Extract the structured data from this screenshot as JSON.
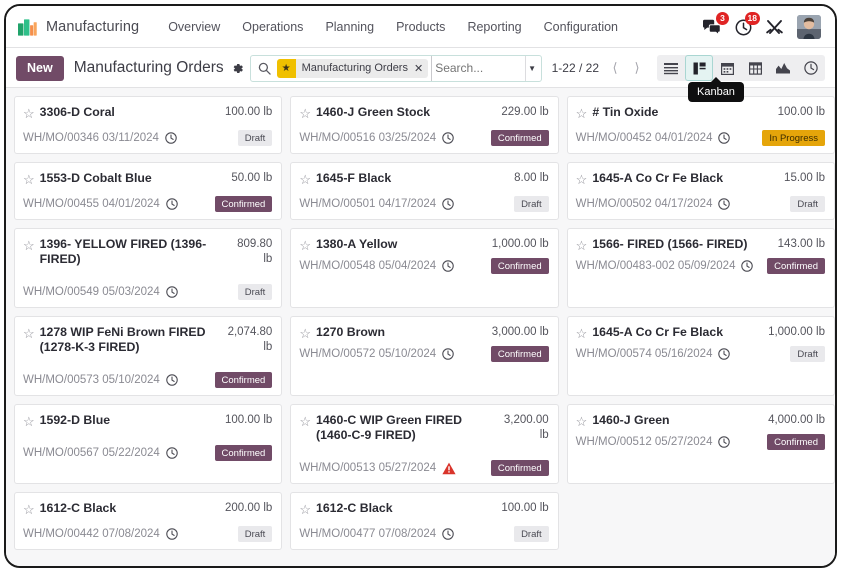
{
  "app": {
    "brand": "Manufacturing",
    "logo_icon": "manufacturing-logo-icon"
  },
  "navmenu": [
    {
      "label": "Overview"
    },
    {
      "label": "Operations"
    },
    {
      "label": "Planning"
    },
    {
      "label": "Products"
    },
    {
      "label": "Reporting"
    },
    {
      "label": "Configuration"
    }
  ],
  "nav_right": {
    "messages_icon": "chat-bubbles-icon",
    "messages_count": "3",
    "activities_icon": "clock-activity-icon",
    "activities_count": "18",
    "debug_icon": "wrench-tools-icon",
    "avatar_icon": "user-avatar"
  },
  "controlpanel": {
    "new_label": "New",
    "title": "Manufacturing Orders",
    "gear_icon": "gear-icon",
    "search": {
      "icon": "search-icon",
      "facet_star_icon": "star-filled-icon",
      "facet_label": "Manufacturing Orders",
      "facet_remove_icon": "close-x-icon",
      "placeholder": "Search...",
      "value": "",
      "dropdown_icon": "caret-down-icon"
    },
    "pager": {
      "count": "1-22 / 22",
      "prev_icon": "chevron-left-icon",
      "next_icon": "chevron-right-icon"
    },
    "views": [
      {
        "name": "list",
        "icon": "list-view-icon",
        "active": false
      },
      {
        "name": "kanban",
        "icon": "kanban-view-icon",
        "active": true
      },
      {
        "name": "calendar",
        "icon": "calendar-view-icon",
        "active": false
      },
      {
        "name": "pivot",
        "icon": "pivot-view-icon",
        "active": false
      },
      {
        "name": "graph",
        "icon": "graph-view-icon",
        "active": false
      },
      {
        "name": "activity",
        "icon": "activity-view-icon",
        "active": false
      }
    ],
    "tooltip": "Kanban"
  },
  "kanban": {
    "columns": [
      {
        "cards": [
          {
            "title": "3306-D Coral",
            "qty": "100.00 lb",
            "ref": "WH/MO/00346 03/11/2024",
            "icon": "clock-icon",
            "state": "Draft",
            "state_class": "draft",
            "tall": false
          },
          {
            "title": "1553-D Cobalt Blue",
            "qty": "50.00 lb",
            "ref": "WH/MO/00455 04/01/2024",
            "icon": "clock-icon",
            "state": "Confirmed",
            "state_class": "confirmed",
            "tall": false
          },
          {
            "title": "1396- YELLOW FIRED (1396- FIRED)",
            "qty": "809.80\nlb",
            "ref": "WH/MO/00549 05/03/2024",
            "icon": "clock-icon",
            "state": "Draft",
            "state_class": "draft",
            "tall": true
          },
          {
            "title": "1278 WIP FeNi Brown FIRED (1278-K-3 FIRED)",
            "qty": "2,074.80\nlb",
            "ref": "WH/MO/00573 05/10/2024",
            "icon": "clock-icon",
            "state": "Confirmed",
            "state_class": "confirmed",
            "tall": true
          },
          {
            "title": "1592-D Blue",
            "qty": "100.00 lb",
            "ref": "WH/MO/00567 05/22/2024",
            "icon": "clock-icon",
            "state": "Confirmed",
            "state_class": "confirmed",
            "tall": true
          },
          {
            "title": "1612-C Black",
            "qty": "200.00 lb",
            "ref": "WH/MO/00442 07/08/2024",
            "icon": "clock-icon",
            "state": "Draft",
            "state_class": "draft",
            "tall": false
          }
        ]
      },
      {
        "cards": [
          {
            "title": "1460-J Green Stock",
            "qty": "229.00 lb",
            "ref": "WH/MO/00516 03/25/2024",
            "icon": "clock-icon",
            "state": "Confirmed",
            "state_class": "confirmed",
            "tall": false
          },
          {
            "title": "1645-F Black",
            "qty": "8.00 lb",
            "ref": "WH/MO/00501 04/17/2024",
            "icon": "clock-icon",
            "state": "Draft",
            "state_class": "draft",
            "tall": false
          },
          {
            "title": "1380-A Yellow",
            "qty": "1,000.00 lb",
            "ref": "WH/MO/00548 05/04/2024",
            "icon": "clock-icon",
            "state": "Confirmed",
            "state_class": "confirmed",
            "tall": true
          },
          {
            "title": "1270 Brown",
            "qty": "3,000.00 lb",
            "ref": "WH/MO/00572 05/10/2024",
            "icon": "clock-icon",
            "state": "Confirmed",
            "state_class": "confirmed",
            "tall": true
          },
          {
            "title": "1460-C WIP Green FIRED (1460-C-9 FIRED)",
            "qty": "3,200.00\nlb",
            "ref": "WH/MO/00513 05/27/2024",
            "icon": "alert-icon",
            "state": "Confirmed",
            "state_class": "confirmed",
            "tall": true
          },
          {
            "title": "1612-C Black",
            "qty": "100.00 lb",
            "ref": "WH/MO/00477 07/08/2024",
            "icon": "clock-icon",
            "state": "Draft",
            "state_class": "draft",
            "tall": false
          }
        ]
      },
      {
        "cards": [
          {
            "title": "# Tin Oxide",
            "qty": "100.00 lb",
            "ref": "WH/MO/00452 04/01/2024",
            "icon": "clock-icon",
            "state": "In Progress",
            "state_class": "progress",
            "tall": false
          },
          {
            "title": "1645-A Co Cr Fe Black",
            "qty": "15.00 lb",
            "ref": "WH/MO/00502 04/17/2024",
            "icon": "clock-icon",
            "state": "Draft",
            "state_class": "draft",
            "tall": false
          },
          {
            "title": "1566- FIRED (1566- FIRED)",
            "qty": "143.00 lb",
            "ref": "WH/MO/00483-002 05/09/2024",
            "icon": "clock-icon",
            "state": "Confirmed",
            "state_class": "confirmed",
            "tall": true
          },
          {
            "title": "1645-A Co Cr Fe Black",
            "qty": "1,000.00 lb",
            "ref": "WH/MO/00574 05/16/2024",
            "icon": "clock-icon",
            "state": "Draft",
            "state_class": "draft",
            "tall": true
          },
          {
            "title": "1460-J Green",
            "qty": "4,000.00 lb",
            "ref": "WH/MO/00512 05/27/2024",
            "icon": "clock-icon",
            "state": "Confirmed",
            "state_class": "confirmed",
            "tall": true
          }
        ]
      }
    ]
  },
  "colors": {
    "primary": "#714b67",
    "in_progress": "#e5a50a",
    "draft_bg": "#e9e9ec",
    "badge_red": "#e02424",
    "facet_star": "#f0c000"
  }
}
